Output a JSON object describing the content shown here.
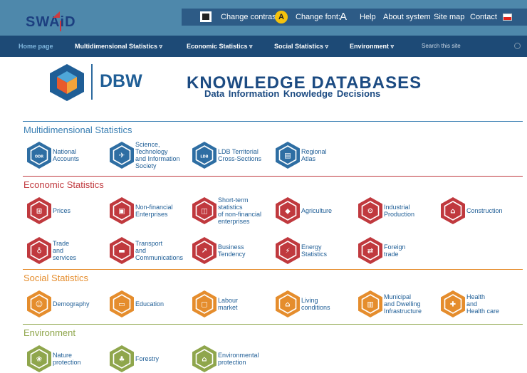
{
  "header": {
    "logo_text": "SWAiD",
    "change_contrast": "Change contrast:",
    "contrast_button": "A",
    "change_font": "Change font:",
    "font_button": "A",
    "help": "Help",
    "about": "About system",
    "sitemap": "Site map",
    "contact": "Contact"
  },
  "nav": {
    "home": "Home page",
    "multi": "Multidimensional Statistics",
    "economic": "Economic Statistics",
    "social": "Social Statistics",
    "environment": "Environment",
    "chevron": "▿",
    "search_placeholder": "Search this site"
  },
  "banner": {
    "dbw": "DBW",
    "title": "KNOWLEDGE  DATABASES",
    "subtitle": "Data  Information  Knowledge  Decisions"
  },
  "colors": {
    "multi": "#3a7fb3",
    "economic": "#c0393e",
    "social": "#e58d2d",
    "environment": "#8fa64c",
    "tile_blue": "#2e6ea3",
    "tile_red": "#c0393e",
    "tile_orange": "#e58d2d",
    "tile_green": "#8fa64c"
  },
  "sections": [
    {
      "title": "Multidimensional Statistics",
      "tiles": [
        {
          "label": [
            "National",
            "Accounts"
          ],
          "icon": "odr-icon",
          "glyph": "ODR"
        },
        {
          "label": [
            "Science,",
            "Technology",
            "and Information",
            "Society"
          ],
          "icon": "satellite-icon",
          "glyph": "✈"
        },
        {
          "label": [
            "LDB Territorial",
            "Cross-Sections"
          ],
          "icon": "ldb-icon",
          "glyph": "LDB"
        },
        {
          "label": [
            "Regional",
            "Atlas"
          ],
          "icon": "atlas-icon",
          "glyph": "▤"
        }
      ]
    },
    {
      "title": "Economic Statistics",
      "tiles": [
        {
          "label": [
            "Prices"
          ],
          "icon": "shopping-basket-icon",
          "glyph": "⊞"
        },
        {
          "label": [
            "Non-financial",
            "Enterprises"
          ],
          "icon": "enterprise-icon",
          "glyph": "▣"
        },
        {
          "label": [
            "Short-term",
            "statistics",
            "of non-financial",
            "enterprises"
          ],
          "icon": "short-term-icon",
          "glyph": "◫"
        },
        {
          "label": [
            "Agriculture"
          ],
          "icon": "agriculture-icon",
          "glyph": "◆"
        },
        {
          "label": [
            "Industrial",
            "Production"
          ],
          "icon": "industry-icon",
          "glyph": "⚙"
        },
        {
          "label": [
            "Construction"
          ],
          "icon": "construction-icon",
          "glyph": "⌂"
        },
        {
          "label": [
            "Trade",
            "and",
            "services"
          ],
          "icon": "cart-icon",
          "glyph": "♁"
        },
        {
          "label": [
            "Transport",
            "and",
            "Communications"
          ],
          "icon": "transport-icon",
          "glyph": "▬"
        },
        {
          "label": [
            "Business",
            "Tendency"
          ],
          "icon": "business-chart-icon",
          "glyph": "↗"
        },
        {
          "label": [
            "Energy",
            "Statistics"
          ],
          "icon": "energy-icon",
          "glyph": "⚡"
        },
        {
          "label": [
            "Foreign",
            "trade"
          ],
          "icon": "foreign-trade-icon",
          "glyph": "⇄"
        }
      ]
    },
    {
      "title": "Social Statistics",
      "tiles": [
        {
          "label": [
            "Demography"
          ],
          "icon": "demography-icon",
          "glyph": "☺"
        },
        {
          "label": [
            "Education"
          ],
          "icon": "education-icon",
          "glyph": "▭"
        },
        {
          "label": [
            "Labour",
            "market"
          ],
          "icon": "labour-icon",
          "glyph": "▢"
        },
        {
          "label": [
            "Living",
            "conditions"
          ],
          "icon": "living-icon",
          "glyph": "⌂"
        },
        {
          "label": [
            "Municipal",
            "and Dwelling",
            "Infrastructure"
          ],
          "icon": "municipal-icon",
          "glyph": "▥"
        },
        {
          "label": [
            "Health",
            "and",
            "Health care"
          ],
          "icon": "health-icon",
          "glyph": "✚"
        }
      ]
    },
    {
      "title": "Environment",
      "tiles": [
        {
          "label": [
            "Nature",
            "protection"
          ],
          "icon": "nature-icon",
          "glyph": "❀"
        },
        {
          "label": [
            "Forestry"
          ],
          "icon": "forestry-icon",
          "glyph": "♣"
        },
        {
          "label": [
            "Environmental",
            "protection"
          ],
          "icon": "environment-icon",
          "glyph": "⌂"
        }
      ]
    }
  ]
}
